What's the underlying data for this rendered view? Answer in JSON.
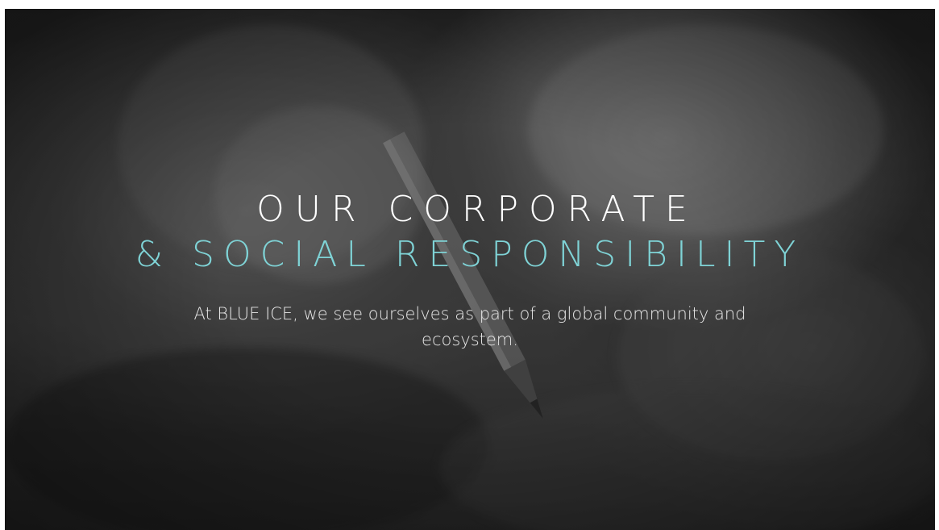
{
  "hero": {
    "heading_line1": "OUR CORPORATE",
    "heading_line2": "& SOCIAL RESPONSIBILITY",
    "subtitle": "At BLUE ICE, we see ourselves as part of a global community and ecosystem."
  },
  "colors": {
    "heading_primary": "#ffffff",
    "heading_accent": "#7fd3d6",
    "subtitle": "#e6e6e6"
  }
}
